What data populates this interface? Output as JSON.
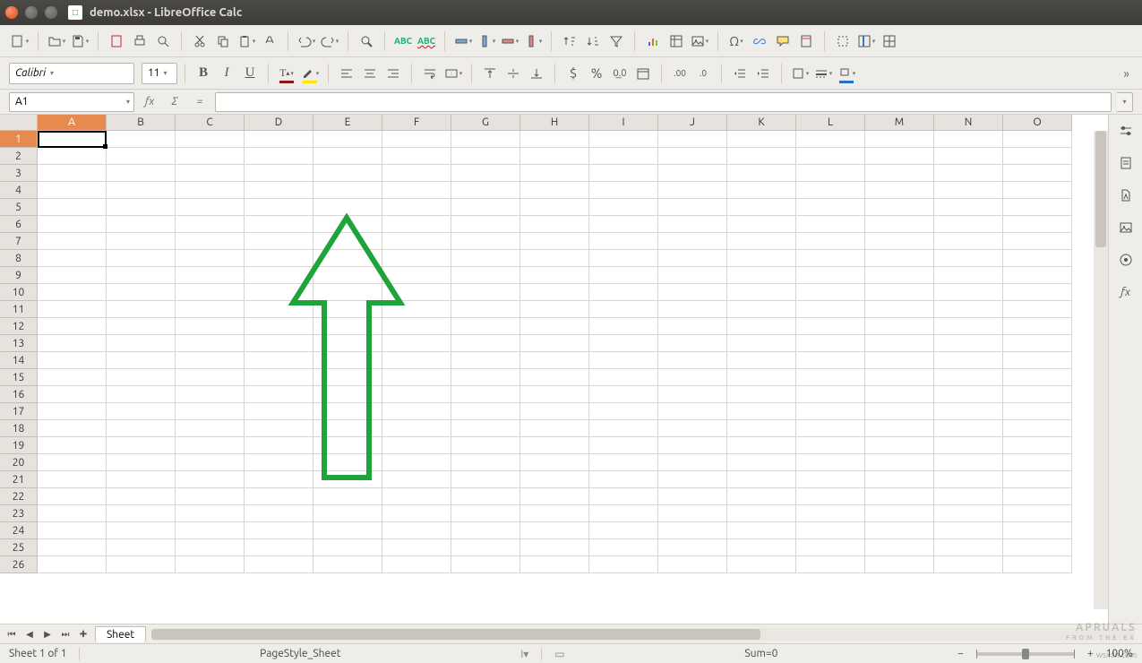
{
  "window": {
    "title": "demo.xlsx - LibreOffice Calc"
  },
  "font": {
    "name": "Calibri",
    "size": "11"
  },
  "cell_ref": "A1",
  "formula": "",
  "columns": [
    "A",
    "B",
    "C",
    "D",
    "E",
    "F",
    "G",
    "H",
    "I",
    "J",
    "K",
    "L",
    "M",
    "N",
    "O"
  ],
  "row_count": 26,
  "selected_col": "A",
  "selected_row": 1,
  "tabs": {
    "sheet1": "Sheet"
  },
  "status": {
    "sheet_info": "Sheet 1 of 1",
    "page_style": "PageStyle_Sheet",
    "sum": "Sum=0",
    "zoom": "100%"
  },
  "watermark": {
    "brand": "APRUALS",
    "tagline": "FROM THE EX",
    "url": "wsxdn.com"
  },
  "icons": {
    "font_color": "#8b1a1a",
    "highlight_color": "#ffe600"
  }
}
